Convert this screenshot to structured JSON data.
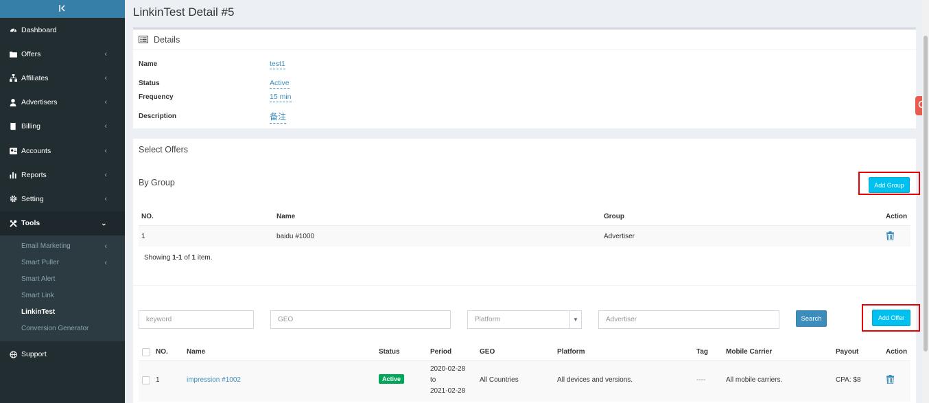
{
  "sidebar": {
    "toggle_icon": "collapse-left-icon",
    "items": [
      {
        "label": "Dashboard",
        "icon": "dashboard-icon",
        "has_children": false
      },
      {
        "label": "Offers",
        "icon": "folder-icon",
        "has_children": true
      },
      {
        "label": "Affiliates",
        "icon": "sitemap-icon",
        "has_children": true
      },
      {
        "label": "Advertisers",
        "icon": "user-icon",
        "has_children": true
      },
      {
        "label": "Billing",
        "icon": "book-icon",
        "has_children": true
      },
      {
        "label": "Accounts",
        "icon": "id-card-icon",
        "has_children": true
      },
      {
        "label": "Reports",
        "icon": "bar-chart-icon",
        "has_children": true
      },
      {
        "label": "Setting",
        "icon": "gear-icon",
        "has_children": true
      },
      {
        "label": "Tools",
        "icon": "tools-icon",
        "has_children": true,
        "expanded": true
      }
    ],
    "tools_sub": [
      {
        "label": "Email Marketing",
        "has_children": true
      },
      {
        "label": "Smart Puller",
        "has_children": true
      },
      {
        "label": "Smart Alert",
        "has_children": false
      },
      {
        "label": "Smart Link",
        "has_children": false
      },
      {
        "label": "LinkinTest",
        "has_children": false,
        "current": true
      },
      {
        "label": "Conversion Generator",
        "has_children": false
      }
    ],
    "support": {
      "label": "Support",
      "icon": "globe-icon"
    }
  },
  "page": {
    "title": "LinkinTest Detail #5"
  },
  "details": {
    "header": "Details",
    "rows": [
      {
        "label": "Name",
        "value": "test1"
      },
      {
        "label": "Status",
        "value": "Active"
      },
      {
        "label": "Frequency",
        "value": "15 min"
      },
      {
        "label": "Description",
        "value": "备注"
      }
    ]
  },
  "select_offers": {
    "title": "Select Offers",
    "by_group": {
      "title": "By Group",
      "add_button": "Add Group",
      "columns": [
        "NO.",
        "Name",
        "Group",
        "Action"
      ],
      "rows": [
        {
          "no": "1",
          "name": "baidu #1000",
          "group": "Advertiser"
        }
      ],
      "summary_prefix": "Showing ",
      "summary_range": "1-1",
      "summary_of": " of ",
      "summary_total": "1",
      "summary_suffix": " item."
    },
    "filters": {
      "keyword_placeholder": "keyword",
      "geo_placeholder": "GEO",
      "platform_placeholder": "Platform",
      "advertiser_placeholder": "Advertiser",
      "search_button": "Search",
      "add_button": "Add Offer"
    },
    "offers_table": {
      "columns": [
        "NO.",
        "Name",
        "Status",
        "Period",
        "GEO",
        "Platform",
        "Tag",
        "Mobile Carrier",
        "Payout",
        "Action"
      ],
      "rows": [
        {
          "no": "1",
          "name": "impression #1002",
          "status": "Active",
          "period_start": "2020-02-28",
          "period_to": "to",
          "period_end": "2021-02-28",
          "geo": "All Countries",
          "platform": "All devices and versions.",
          "tag": "----",
          "carrier": "All mobile carriers.",
          "payout": "CPA: $8"
        }
      ]
    }
  },
  "colors": {
    "sidebar_bg": "#222d32",
    "sidebar_top": "#367fa9",
    "accent_info": "#00c0ef",
    "primary": "#3c8dbc",
    "success": "#00a65a",
    "highlight_outline": "#e60000"
  }
}
